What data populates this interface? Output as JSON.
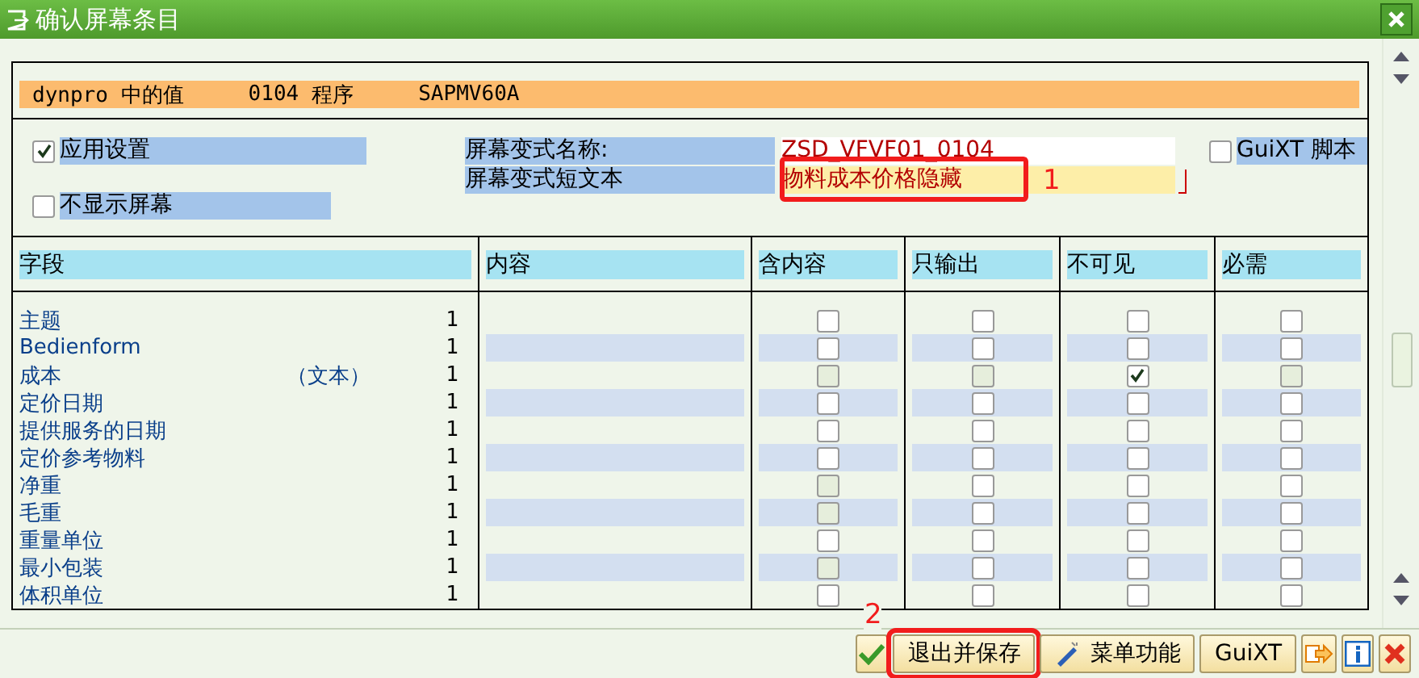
{
  "window": {
    "title": "确认屏幕条目"
  },
  "info_bar": {
    "label": "dynpro 中的值",
    "number": "0104",
    "program_label": "程序",
    "program": "SAPMV60A"
  },
  "settings": {
    "apply": {
      "label": "应用设置",
      "checked": true
    },
    "hide": {
      "label": "不显示屏幕",
      "checked": false
    },
    "variant_name": {
      "label": "屏幕变式名称:",
      "value": "ZSD_VFVF01_0104"
    },
    "variant_text": {
      "label": "屏幕变式短文本",
      "value": "物料成本价格隐藏",
      "highlighted": true,
      "annotation": "1"
    },
    "guixt": {
      "label": "GuiXT 脚本",
      "checked": false
    }
  },
  "table": {
    "columns": [
      "字段",
      "内容",
      "含内容",
      "只输出",
      "不可见",
      "必需"
    ],
    "rows": [
      {
        "field": "主题",
        "count": "1",
        "flags": [
          {
            "checked": false,
            "disabled": false
          },
          {
            "checked": false,
            "disabled": false
          },
          {
            "checked": false,
            "disabled": false
          },
          {
            "checked": false,
            "disabled": false
          }
        ]
      },
      {
        "field": "Bedienform",
        "count": "1",
        "flags": [
          {
            "checked": false,
            "disabled": false
          },
          {
            "checked": false,
            "disabled": false
          },
          {
            "checked": false,
            "disabled": false
          },
          {
            "checked": false,
            "disabled": false
          }
        ]
      },
      {
        "field": "成本",
        "note": "（文本）",
        "count": "1",
        "flags": [
          {
            "checked": false,
            "disabled": true
          },
          {
            "checked": false,
            "disabled": true
          },
          {
            "checked": true,
            "disabled": false
          },
          {
            "checked": false,
            "disabled": true
          }
        ]
      },
      {
        "field": "定价日期",
        "count": "1",
        "flags": [
          {
            "checked": false,
            "disabled": false
          },
          {
            "checked": false,
            "disabled": false
          },
          {
            "checked": false,
            "disabled": false
          },
          {
            "checked": false,
            "disabled": false
          }
        ]
      },
      {
        "field": "提供服务的日期",
        "count": "1",
        "flags": [
          {
            "checked": false,
            "disabled": false
          },
          {
            "checked": false,
            "disabled": false
          },
          {
            "checked": false,
            "disabled": false
          },
          {
            "checked": false,
            "disabled": false
          }
        ]
      },
      {
        "field": "定价参考物料",
        "count": "1",
        "flags": [
          {
            "checked": false,
            "disabled": false
          },
          {
            "checked": false,
            "disabled": false
          },
          {
            "checked": false,
            "disabled": false
          },
          {
            "checked": false,
            "disabled": false
          }
        ]
      },
      {
        "field": "净重",
        "count": "1",
        "flags": [
          {
            "checked": false,
            "disabled": true
          },
          {
            "checked": false,
            "disabled": false
          },
          {
            "checked": false,
            "disabled": false
          },
          {
            "checked": false,
            "disabled": false
          }
        ]
      },
      {
        "field": "毛重",
        "count": "1",
        "flags": [
          {
            "checked": false,
            "disabled": true
          },
          {
            "checked": false,
            "disabled": false
          },
          {
            "checked": false,
            "disabled": false
          },
          {
            "checked": false,
            "disabled": false
          }
        ]
      },
      {
        "field": "重量单位",
        "count": "1",
        "flags": [
          {
            "checked": false,
            "disabled": false
          },
          {
            "checked": false,
            "disabled": false
          },
          {
            "checked": false,
            "disabled": false
          },
          {
            "checked": false,
            "disabled": false
          }
        ]
      },
      {
        "field": "最小包装",
        "count": "1",
        "flags": [
          {
            "checked": false,
            "disabled": true
          },
          {
            "checked": false,
            "disabled": false
          },
          {
            "checked": false,
            "disabled": false
          },
          {
            "checked": false,
            "disabled": false
          }
        ]
      },
      {
        "field": "体积单位",
        "count": "1",
        "flags": [
          {
            "checked": false,
            "disabled": false
          },
          {
            "checked": false,
            "disabled": false
          },
          {
            "checked": false,
            "disabled": false
          },
          {
            "checked": false,
            "disabled": false
          }
        ]
      }
    ]
  },
  "buttons": [
    {
      "kind": "confirm",
      "highlighted": false
    },
    {
      "kind": "text",
      "label": "退出并保存",
      "highlighted": true,
      "annotation": "2"
    },
    {
      "kind": "menu",
      "label": "菜单功能",
      "highlighted": false
    },
    {
      "kind": "text",
      "label": "GuiXT",
      "highlighted": false
    },
    {
      "kind": "transfer",
      "highlighted": false
    },
    {
      "kind": "info",
      "highlighted": false
    },
    {
      "kind": "cancel",
      "highlighted": false
    }
  ]
}
